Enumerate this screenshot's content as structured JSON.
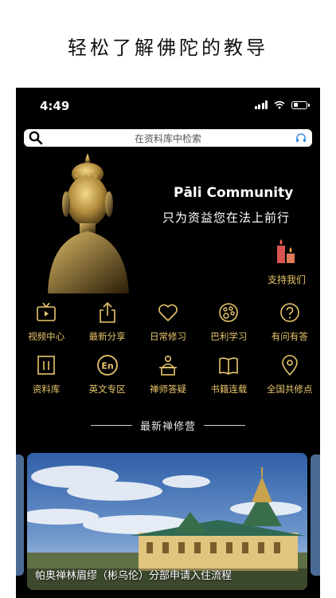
{
  "headline": "轻松了解佛陀的教导",
  "status_bar": {
    "time": "4:49"
  },
  "search": {
    "placeholder": "在资料库中检索"
  },
  "hero": {
    "title": "Pāli Community",
    "subtitle": "只为资益您在法上前行",
    "support_label": "支持我们"
  },
  "menu": {
    "row1": [
      {
        "label": "视频中心",
        "icon": "tv-icon"
      },
      {
        "label": "最新分享",
        "icon": "share-icon"
      },
      {
        "label": "日常修习",
        "icon": "heart-icon"
      },
      {
        "label": "巴利学习",
        "icon": "palette-icon"
      },
      {
        "label": "有问有答",
        "icon": "question-icon"
      }
    ],
    "row2": [
      {
        "label": "资料库",
        "icon": "library-icon"
      },
      {
        "label": "英文专区",
        "icon": "english-icon"
      },
      {
        "label": "禅师答疑",
        "icon": "teacher-icon"
      },
      {
        "label": "书籍连载",
        "icon": "book-icon"
      },
      {
        "label": "全国共修点",
        "icon": "location-pin-icon"
      }
    ]
  },
  "section": {
    "title": "最新禅修营"
  },
  "banner": {
    "caption": "帕奥禅林眉缪（彬乌伦）分部申请入住流程"
  },
  "colors": {
    "accent": "#e8c66a",
    "background": "#000000"
  }
}
